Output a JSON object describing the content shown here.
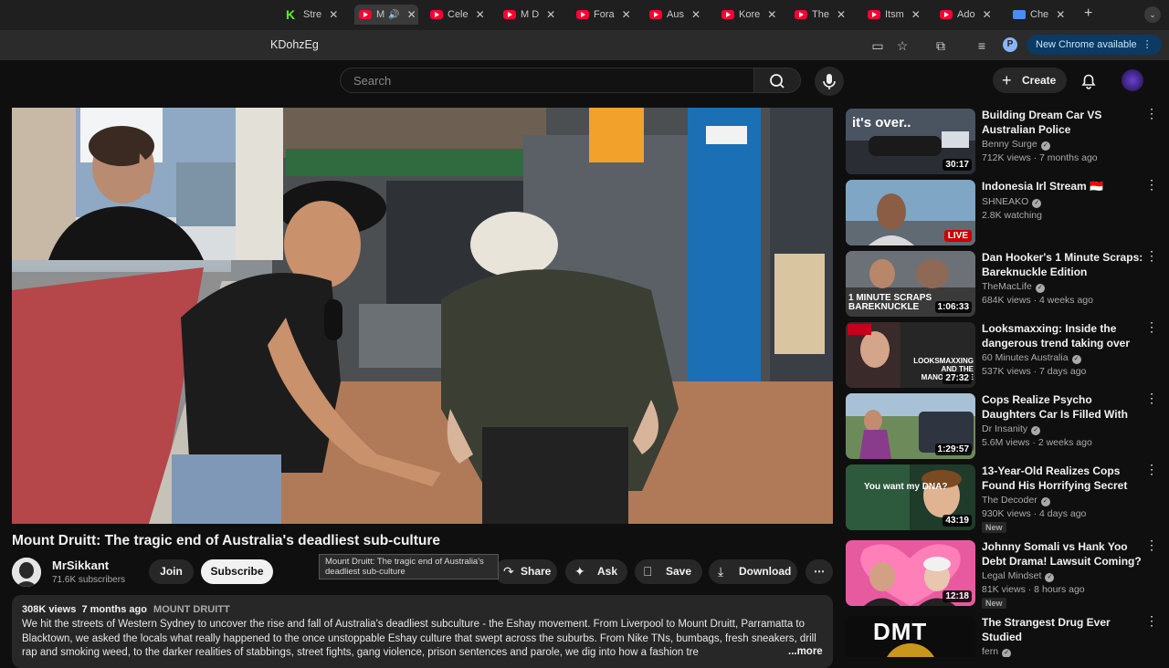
{
  "browser": {
    "tabs": [
      {
        "label": "Stre",
        "icon": "kick-icon"
      },
      {
        "label": "M",
        "icon": "youtube-icon",
        "active": true
      },
      {
        "label": "Cele",
        "icon": "youtube-icon"
      },
      {
        "label": "M D",
        "icon": "youtube-icon"
      },
      {
        "label": "Fora",
        "icon": "youtube-icon"
      },
      {
        "label": "Aus",
        "icon": "youtube-icon"
      },
      {
        "label": "Kore",
        "icon": "youtube-icon"
      },
      {
        "label": "The",
        "icon": "youtube-icon"
      },
      {
        "label": "Itsm",
        "icon": "youtube-icon"
      },
      {
        "label": "Ado",
        "icon": "youtube-icon"
      },
      {
        "label": "Che",
        "icon": "chrome-icon"
      }
    ],
    "url": "KDohzEg",
    "profile_initial": "P",
    "new_chrome_label": "New Chrome available"
  },
  "youtube": {
    "search_placeholder": "Search",
    "create_label": "Create"
  },
  "video": {
    "title": "Mount Druitt: The tragic end of Australia's deadliest sub-culture",
    "tooltip": "Mount Druitt: The tragic end of Australia's deadliest sub-culture",
    "channel_name": "MrSikkant",
    "subscribers": "71.6K subscribers",
    "join_label": "Join",
    "subscribe_label": "Subscribe",
    "share_label": "Share",
    "ask_label": "Ask",
    "save_label": "Save",
    "download_label": "Download",
    "views": "308K views",
    "age": "7 months ago",
    "tag": "MOUNT DRUITT",
    "description": "We hit the streets of Western Sydney to uncover the rise and fall of Australia's deadliest subculture - the Eshay movement. From Liverpool to Mount Druitt, Parramatta to Blacktown, we asked the locals what really happened to the once unstoppable Eshay culture that swept across the suburbs. From Nike TNs, bumbags, fresh sneakers, drill rap and smoking weed, to the darker realities of stabbings, street fights, gang violence, prison sentences and parole, we dig into how a fashion tre",
    "more_label": "...more"
  },
  "recommendations": [
    {
      "title": "Building Dream Car VS Australian Police",
      "channel": "Benny Surge",
      "verified": true,
      "meta": "712K views · 7 months ago",
      "badge": "30:17",
      "thumb_text": "it's over.."
    },
    {
      "title": "Indonesia Irl Stream 🇮🇩",
      "channel": "SHNEAKO",
      "verified": true,
      "meta": "2.8K watching",
      "badge": "LIVE",
      "live": true
    },
    {
      "title": "Dan Hooker's 1 Minute Scraps: Bareknuckle Edition",
      "channel": "TheMacLife",
      "verified": true,
      "meta": "684K views · 4 weeks ago",
      "badge": "1:06:33",
      "thumb_text": "1 MINUTE SCRAPS BAREKNUCKLE"
    },
    {
      "title": "Looksmaxxing: Inside the dangerous trend taking over the…",
      "channel": "60 Minutes Australia",
      "verified": true,
      "meta": "537K views · 7 days ago",
      "badge": "27:32",
      "thumb_text": "LOOKSMAXXING AND THE MANOSPHERE"
    },
    {
      "title": "Cops Realize Psycho Daughters Car Is Filled With Bodies",
      "channel": "Dr Insanity",
      "verified": true,
      "meta": "5.6M views · 2 weeks ago",
      "badge": "1:29:57"
    },
    {
      "title": "13-Year-Old Realizes Cops Found His Horrifying Secret",
      "channel": "The Decoder",
      "verified": true,
      "meta": "930K views · 4 days ago",
      "badge": "43:19",
      "new": "New",
      "thumb_text": "You want my DNA?"
    },
    {
      "title": "Johnny Somali vs Hank Yoo Debt Drama! Lawsuit Coming?",
      "channel": "Legal Mindset",
      "verified": true,
      "meta": "81K views · 8 hours ago",
      "badge": "12:18",
      "new": "New"
    },
    {
      "title": "The Strangest Drug Ever Studied",
      "channel": "fern",
      "verified": true,
      "meta": "",
      "badge": "",
      "thumb_text": "DMT"
    }
  ],
  "colors": {
    "youtube_red": "#ff0033",
    "background": "#0f0f0f",
    "chip": "#272727"
  }
}
